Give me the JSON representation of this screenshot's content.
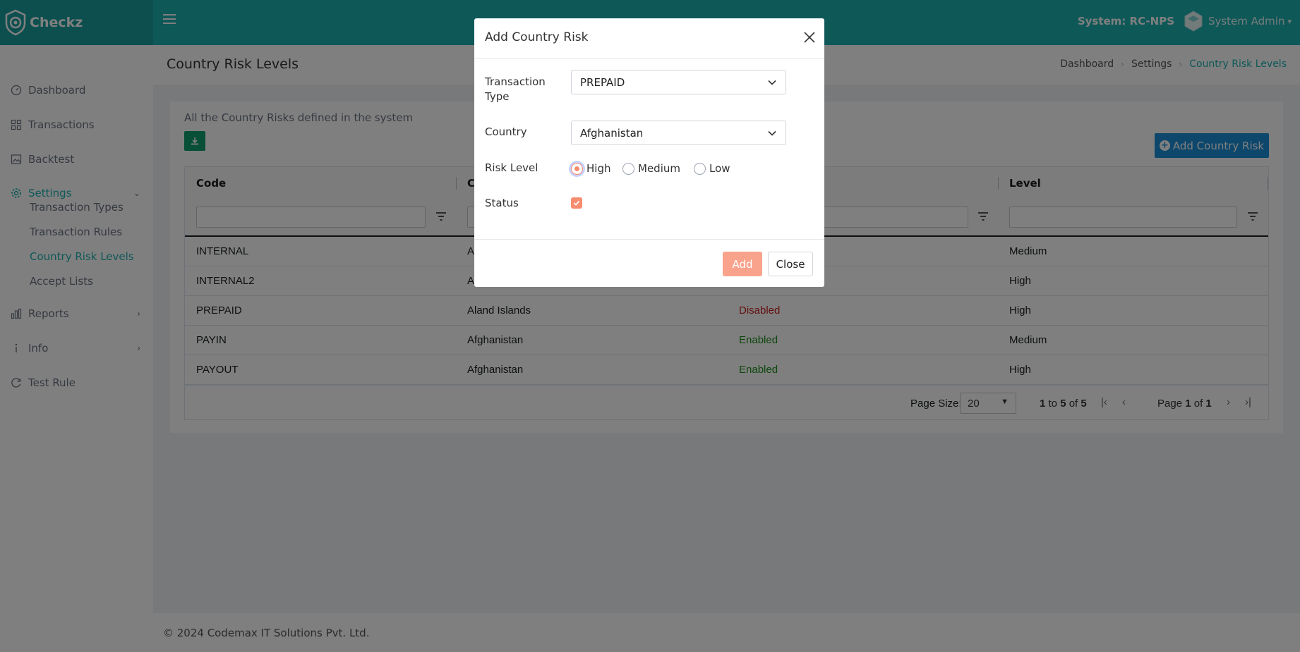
{
  "header": {
    "brand": "Checkz",
    "system": "System: RC-NPS",
    "user": "System Admin"
  },
  "sidebar": {
    "items": [
      {
        "label": "Dashboard",
        "icon": "gauge-icon"
      },
      {
        "label": "Transactions",
        "icon": "grid-icon"
      },
      {
        "label": "Backtest",
        "icon": "image-icon"
      },
      {
        "label": "Settings",
        "icon": "gear-icon"
      },
      {
        "label": "Reports",
        "icon": "bar-chart-icon"
      },
      {
        "label": "Info",
        "icon": "info-icon"
      },
      {
        "label": "Test Rule",
        "icon": "refresh-icon"
      }
    ],
    "settings_sub": [
      "Transaction Types",
      "Transaction Rules",
      "Country Risk Levels",
      "Accept Lists"
    ]
  },
  "page": {
    "title": "Country Risk Levels",
    "breadcrumb": [
      "Dashboard",
      "Settings",
      "Country Risk Levels"
    ],
    "description": "All the Country Risks defined in the system",
    "add_button": "Add Country Risk"
  },
  "grid": {
    "columns": [
      "Code",
      "C",
      "",
      "Level"
    ],
    "rows": [
      {
        "code": "INTERNAL",
        "country": "A",
        "status": "",
        "level": "Medium"
      },
      {
        "code": "INTERNAL2",
        "country": "A",
        "status": "",
        "level": "High"
      },
      {
        "code": "PREPAID",
        "country": "Aland Islands",
        "status": "Disabled",
        "level": "High"
      },
      {
        "code": "PAYIN",
        "country": "Afghanistan",
        "status": "Enabled",
        "level": "Medium"
      },
      {
        "code": "PAYOUT",
        "country": "Afghanistan",
        "status": "Enabled",
        "level": "High"
      }
    ],
    "pagination": {
      "page_size_label": "Page Size:",
      "page_size": "20",
      "from": "1",
      "to_word": "to",
      "to": "5",
      "of_word": "of",
      "total": "5",
      "page_word": "Page",
      "page": "1",
      "pages": "1"
    }
  },
  "modal": {
    "title": "Add Country Risk",
    "transaction_type_label": "Transaction Type",
    "transaction_type_value": "PREPAID",
    "country_label": "Country",
    "country_value": "Afghanistan",
    "risk_level_label": "Risk Level",
    "risk_options": [
      "High",
      "Medium",
      "Low"
    ],
    "risk_selected": "High",
    "status_label": "Status",
    "status_checked": true,
    "add_button": "Add",
    "close_button": "Close"
  },
  "footer": {
    "copyright": "© 2024 Codemax IT Solutions Pvt. Ltd."
  },
  "colors": {
    "brand": "#1fb0b0",
    "accent": "#f78c6f",
    "primary_button": "#1b8fd8",
    "enabled": "#1a8f1a",
    "disabled": "#c81e1e"
  }
}
